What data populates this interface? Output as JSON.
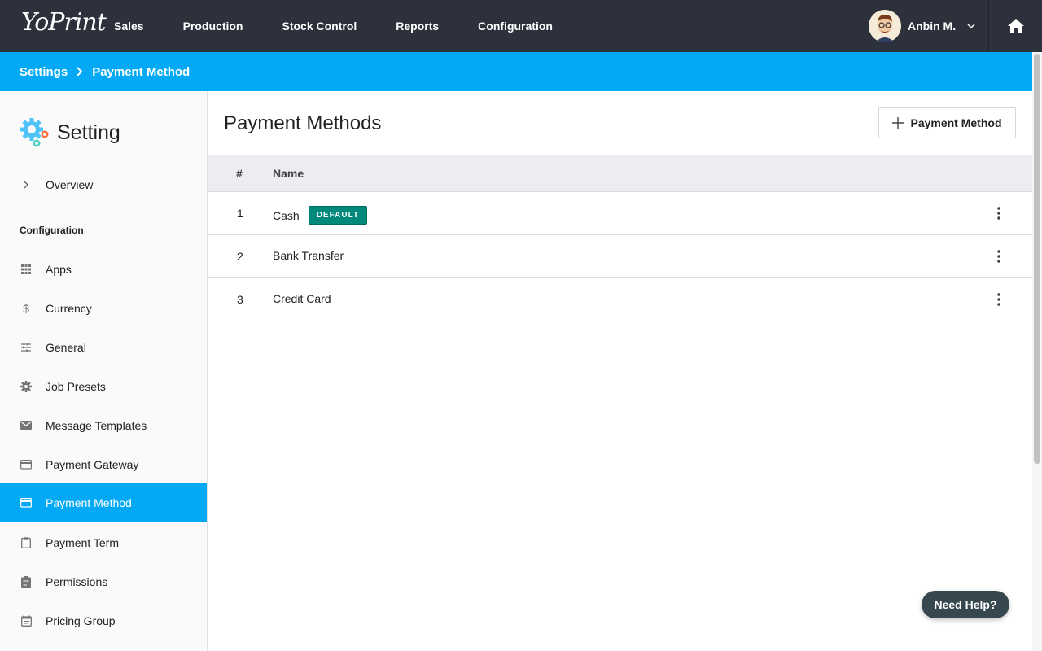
{
  "brand": {
    "logo_text": "YoPrint"
  },
  "nav": {
    "items": [
      {
        "label": "Sales"
      },
      {
        "label": "Production"
      },
      {
        "label": "Stock Control"
      },
      {
        "label": "Reports"
      },
      {
        "label": "Configuration"
      }
    ]
  },
  "user": {
    "name": "Anbin M.",
    "avatar_icon": "user-avatar",
    "menu_icon": "chevron-down-icon"
  },
  "home_icon": "home-icon",
  "breadcrumb": {
    "items": [
      "Settings",
      "Payment Method"
    ]
  },
  "sidebar": {
    "title": "Setting",
    "title_icon": "gears-icon",
    "overview_label": "Overview",
    "section_label": "Configuration",
    "items": [
      {
        "label": "Apps",
        "icon": "apps-grid-icon"
      },
      {
        "label": "Currency",
        "icon": "dollar-icon"
      },
      {
        "label": "General",
        "icon": "tune-sliders-icon"
      },
      {
        "label": "Job Presets",
        "icon": "gear-icon"
      },
      {
        "label": "Message Templates",
        "icon": "envelope-icon"
      },
      {
        "label": "Payment Gateway",
        "icon": "credit-card-icon"
      },
      {
        "label": "Payment Method",
        "icon": "credit-card-icon",
        "active": true
      },
      {
        "label": "Payment Term",
        "icon": "clipboard-icon"
      },
      {
        "label": "Permissions",
        "icon": "assignment-icon"
      },
      {
        "label": "Pricing Group",
        "icon": "calendar-icon"
      }
    ]
  },
  "main": {
    "title": "Payment Methods",
    "add_button_label": "Payment Method",
    "table": {
      "headers": [
        "#",
        "Name"
      ],
      "rows": [
        {
          "num": "1",
          "name": "Cash",
          "badge": "DEFAULT"
        },
        {
          "num": "2",
          "name": "Bank Transfer"
        },
        {
          "num": "3",
          "name": "Credit Card"
        }
      ]
    }
  },
  "help_label": "Need Help?",
  "colors": {
    "navbar": "#2d313c",
    "accent": "#03a9f4",
    "badge": "#00897b",
    "help": "#37474f"
  }
}
